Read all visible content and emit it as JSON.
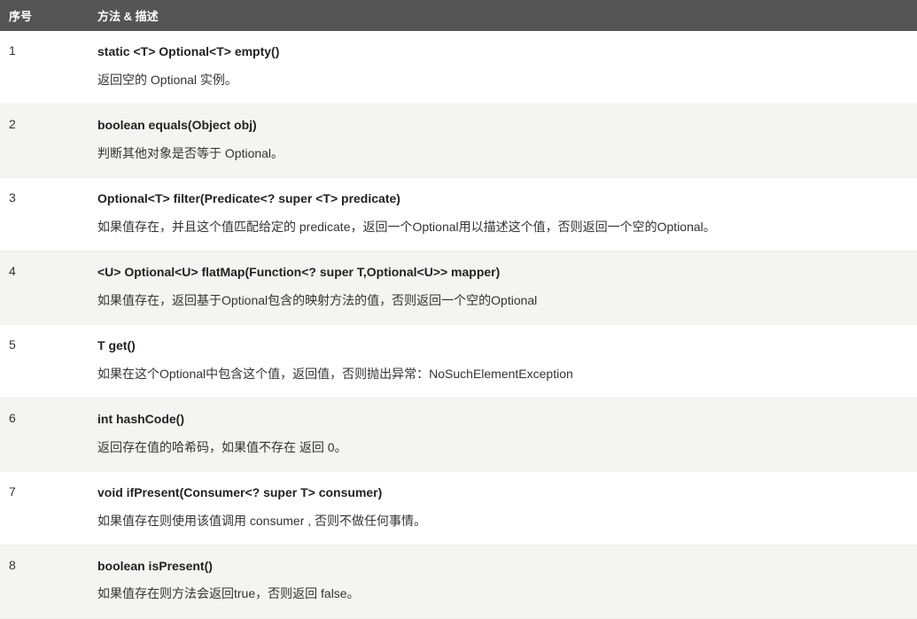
{
  "table": {
    "headers": {
      "num": "序号",
      "method": "方法 & 描述"
    },
    "rows": [
      {
        "num": "1",
        "sig": "static <T> Optional<T> empty()",
        "desc": "返回空的 Optional 实例。"
      },
      {
        "num": "2",
        "sig": "boolean equals(Object obj)",
        "desc": "判断其他对象是否等于 Optional。"
      },
      {
        "num": "3",
        "sig": "Optional<T> filter(Predicate<? super <T> predicate)",
        "desc": "如果值存在，并且这个值匹配给定的 predicate，返回一个Optional用以描述这个值，否则返回一个空的Optional。"
      },
      {
        "num": "4",
        "sig": "<U> Optional<U> flatMap(Function<? super T,Optional<U>> mapper)",
        "desc": "如果值存在，返回基于Optional包含的映射方法的值，否则返回一个空的Optional"
      },
      {
        "num": "5",
        "sig": "T get()",
        "desc": "如果在这个Optional中包含这个值，返回值，否则抛出异常：NoSuchElementException"
      },
      {
        "num": "6",
        "sig": "int hashCode()",
        "desc": "返回存在值的哈希码，如果值不存在 返回 0。"
      },
      {
        "num": "7",
        "sig": "void ifPresent(Consumer<? super T> consumer)",
        "desc": "如果值存在则使用该值调用 consumer , 否则不做任何事情。"
      },
      {
        "num": "8",
        "sig": "boolean isPresent()",
        "desc": "如果值存在则方法会返回true，否则返回 false。"
      }
    ]
  }
}
